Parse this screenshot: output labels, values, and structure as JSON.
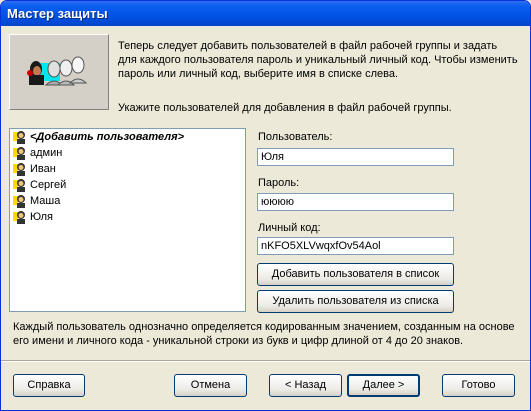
{
  "window": {
    "title": "Мастер защиты"
  },
  "intro_text": "Теперь следует добавить пользователей в файл рабочей группы и задать для каждого пользователя пароль и уникальный личный код. Чтобы изменить пароль или личный код, выберите имя в списке слева.",
  "prompt_text": "Укажите пользователей для добавления в файл рабочей группы.",
  "users_list": [
    "<Добавить пользователя>",
    "админ",
    "Иван",
    "Сергей",
    "Маша",
    "Юля"
  ],
  "fields": {
    "user_label": "Пользователь:",
    "user_value": "Юля",
    "password_label": "Пароль:",
    "password_value": "юююю",
    "pid_label": "Личный код:",
    "pid_value": "nKFO5XLVwqxfOv54Aol"
  },
  "buttons": {
    "add_user": "Добавить пользователя в список",
    "remove_user": "Удалить пользователя из списка",
    "help": "Справка",
    "cancel": "Отмена",
    "back": "< Назад",
    "next": "Далее >",
    "finish": "Готово"
  },
  "note_text": "Каждый пользователь однозначно определяется кодированным значением, созданным на основе его имени и личного кода - уникальной строки из букв и цифр длиной от 4 до 20 знаков.",
  "colors": {
    "titlebar": "#0054e3",
    "dialog_bg": "#ece9d8",
    "header_icon_highlight": "#00e5ee"
  }
}
